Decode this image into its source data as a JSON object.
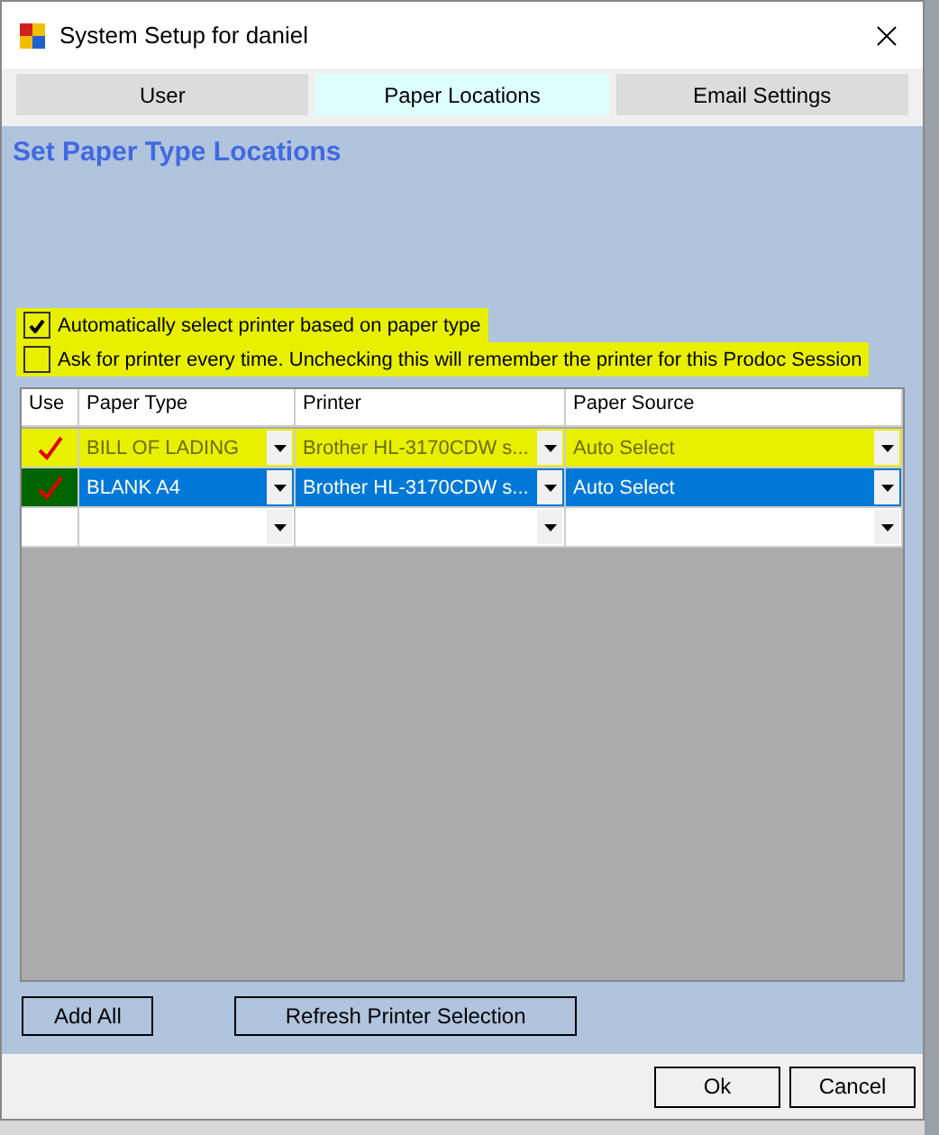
{
  "window": {
    "title": "System Setup for daniel"
  },
  "tabs": [
    {
      "label": "User",
      "selected": false
    },
    {
      "label": "Paper Locations",
      "selected": true
    },
    {
      "label": "Email Settings",
      "selected": false
    }
  ],
  "heading": "Set Paper Type Locations",
  "options": [
    {
      "label": "Automatically select printer based on paper type",
      "checked": true,
      "highlighted": true
    },
    {
      "label": "Ask for printer every time.  Unchecking this will remember the printer for this Prodoc Session",
      "checked": false,
      "highlighted": true
    }
  ],
  "table": {
    "columns": [
      "Use",
      "Paper Type",
      "Printer",
      "Paper Source"
    ],
    "rows": [
      {
        "use": true,
        "paper_type": "BILL OF LADING",
        "printer": "Brother HL-3170CDW s...",
        "paper_source": "Auto Select",
        "selected": false,
        "highlighted": true
      },
      {
        "use": true,
        "paper_type": "BLANK A4",
        "printer": "Brother HL-3170CDW s...",
        "paper_source": "Auto Select",
        "selected": true,
        "highlighted": false
      },
      {
        "use": false,
        "paper_type": "",
        "printer": "",
        "paper_source": "",
        "selected": false,
        "highlighted": false
      }
    ]
  },
  "actions": [
    "Add All",
    "Refresh Printer Selection"
  ],
  "buttons": [
    "Ok",
    "Cancel"
  ]
}
